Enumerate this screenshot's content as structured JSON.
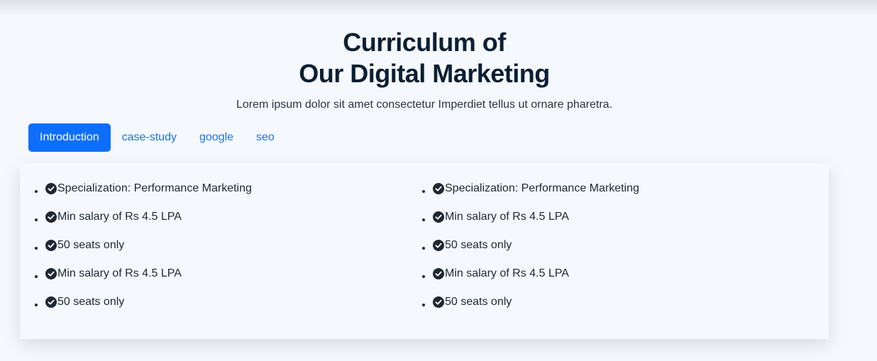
{
  "header": {
    "title_line1": "Curriculum of",
    "title_line2": "Our Digital Marketing",
    "subtitle": "Lorem ipsum dolor sit amet consectetur Imperdiet tellus ut ornare pharetra."
  },
  "tabs": [
    {
      "label": "Introduction",
      "active": true
    },
    {
      "label": "case-study",
      "active": false
    },
    {
      "label": "google",
      "active": false
    },
    {
      "label": "seo",
      "active": false
    }
  ],
  "panel": {
    "left_items": [
      {
        "text": "Specialization: Performance Marketing",
        "icon": "check-circle-icon"
      },
      {
        "text": "Min salary of Rs 4.5 LPA",
        "icon": "check-circle-icon"
      },
      {
        "text": "50 seats only",
        "icon": "check-circle-icon"
      },
      {
        "text": "Min salary of Rs 4.5 LPA",
        "icon": "check-circle-icon"
      },
      {
        "text": "50 seats only",
        "icon": "check-circle-icon"
      }
    ],
    "right_items": [
      {
        "text": "Specialization: Performance Marketing",
        "icon": "check-circle-icon"
      },
      {
        "text": "Min salary of Rs 4.5 LPA",
        "icon": "check-circle-icon"
      },
      {
        "text": "50 seats only",
        "icon": "check-circle-icon"
      },
      {
        "text": "Min salary of Rs 4.5 LPA",
        "icon": "check-circle-icon"
      },
      {
        "text": "50 seats only",
        "icon": "check-circle-icon"
      }
    ]
  },
  "colors": {
    "accent": "#0d6efd",
    "link": "#1a73e8",
    "title": "#0c1f33",
    "background": "#f5f9fe"
  }
}
